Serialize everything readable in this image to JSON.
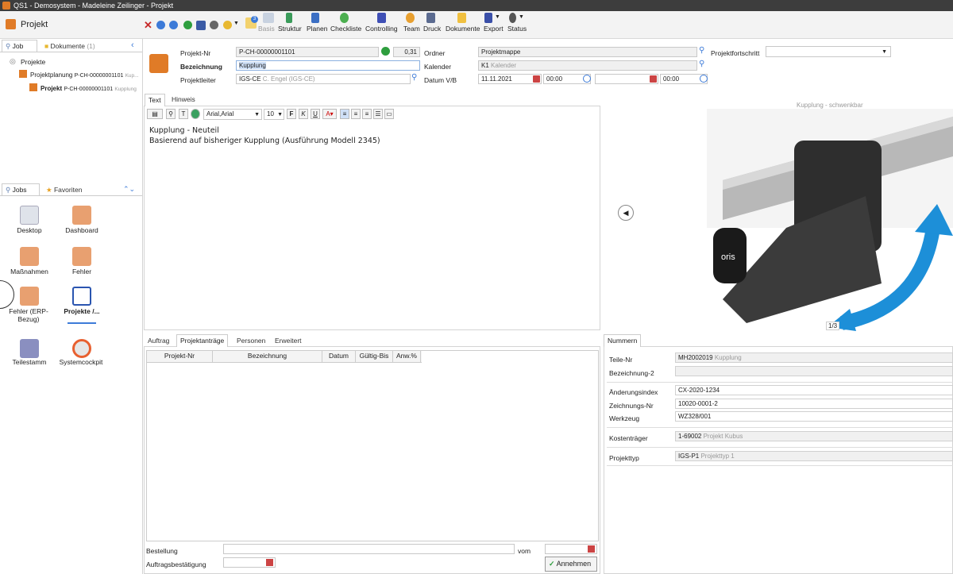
{
  "window": {
    "title": "QS1 - Demosystem - Madeleine Zeilinger - Projekt"
  },
  "app": {
    "title": "Projekt"
  },
  "toolbar": {
    "buttons": [
      {
        "label": "Basis"
      },
      {
        "label": "Struktur"
      },
      {
        "label": "Planen"
      },
      {
        "label": "Checkliste"
      },
      {
        "label": "Controlling"
      },
      {
        "label": "Team"
      },
      {
        "label": "Druck"
      },
      {
        "label": "Dokumente"
      },
      {
        "label": "Export"
      },
      {
        "label": "Status"
      }
    ],
    "badge": "3"
  },
  "left": {
    "tabs": {
      "job": "Job",
      "dokumente": "Dokumente",
      "dokumente_count": "(1)"
    },
    "tree": {
      "root": "Projekte",
      "planung": "Projektplanung",
      "planung_nr": "P-CH-00000001101",
      "planung_suffix": "Kup...",
      "projekt": "Projekt",
      "projekt_nr": "P-CH-00000001101",
      "projekt_suffix": "Kupplung"
    },
    "jobs_tabs": {
      "jobs": "Jobs",
      "favoriten": "Favoriten"
    },
    "jobs": [
      {
        "label": "Desktop"
      },
      {
        "label": "Dashboard"
      },
      {
        "label": "Maßnahmen"
      },
      {
        "label": "Fehler"
      },
      {
        "label": "Fehler (ERP-Bezug)"
      },
      {
        "label": "Projekte /..."
      },
      {
        "label": "Teilestamm"
      },
      {
        "label": "Systemcockpit"
      }
    ]
  },
  "header": {
    "projekt_nr_label": "Projekt-Nr",
    "projekt_nr": "P-CH-00000001101",
    "progress": "0,31",
    "bezeichnung_label": "Bezeichnung",
    "bezeichnung": "Kupplung",
    "projektleiter_label": "Projektleiter",
    "projektleiter_code": "IGS-CE",
    "projektleiter_name": "C. Engel (IGS-CE)",
    "ordner_label": "Ordner",
    "ordner": "Projektmappe",
    "kalender_label": "Kalender",
    "kalender_code": "K1",
    "kalender_name": "Kalender",
    "datum_label": "Datum V/B",
    "datum_von": "11.11.2021",
    "zeit_von": "00:00",
    "zeit_bis": "00:00",
    "fortschritt_label": "Projektfortschritt"
  },
  "text_panel": {
    "tabs": {
      "text": "Text",
      "hinweis": "Hinweis"
    },
    "font": "Arial,Arial",
    "size": "10",
    "lines": [
      "Kupplung - Neuteil",
      "Basierend auf bisheriger Kupplung (Ausführung Modell 2345)"
    ]
  },
  "image_panel": {
    "caption": "Kupplung - schwenkbar",
    "counter": "1/3",
    "brand": "oris"
  },
  "orders": {
    "tabs": {
      "auftrag": "Auftrag",
      "projektantraege": "Projektanträge",
      "personen": "Personen",
      "erweitert": "Erweitert"
    },
    "columns": [
      "Projekt-Nr",
      "Bezeichnung",
      "Datum",
      "Gültig-Bis",
      "Anw.%"
    ],
    "bestellung_label": "Bestellung",
    "vom_label": "vom",
    "bestaetigung_label": "Auftragsbestätigung",
    "annehmen": "Annehmen"
  },
  "numbers": {
    "tab": "Nummern",
    "teile_nr_label": "Teile-Nr",
    "teile_nr": "MH2002019",
    "teile_nr_name": "Kupplung",
    "bez2_label": "Bezeichnung-2",
    "aenderung_label": "Änderungsindex",
    "aenderung": "CX-2020-1234",
    "zeichnung_label": "Zeichnungs-Nr",
    "zeichnung": "10020-0001-2",
    "werkzeug_label": "Werkzeug",
    "werkzeug": "WZ328/001",
    "kosten_label": "Kostenträger",
    "kosten": "1-69002",
    "kosten_name": "Projekt Kubus",
    "typ_label": "Projekttyp",
    "typ": "IGS-P1",
    "typ_name": "Projekttyp 1"
  }
}
